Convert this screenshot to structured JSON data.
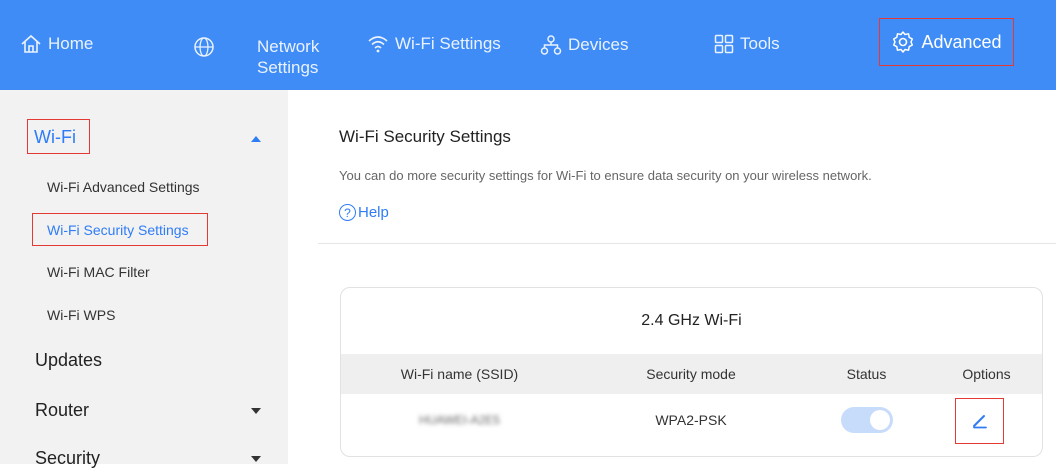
{
  "topbar": {
    "home": "Home",
    "network_line1": "Network",
    "network_line2": "Settings",
    "wifi_settings": "Wi-Fi Settings",
    "devices": "Devices",
    "tools": "Tools",
    "advanced": "Advanced",
    "bg_color": "#3f8cf6"
  },
  "sidebar": {
    "wifi_title": "Wi-Fi",
    "items": [
      "Wi-Fi Advanced Settings",
      "Wi-Fi Security Settings",
      "Wi-Fi MAC Filter",
      "Wi-Fi WPS"
    ],
    "updates": "Updates",
    "router": "Router",
    "security": "Security"
  },
  "main": {
    "title": "Wi-Fi Security Settings",
    "description": "You can do more security settings for Wi-Fi to ensure data security on your wireless network.",
    "help_q": "?",
    "help": "Help"
  },
  "card": {
    "title": "2.4 GHz Wi-Fi",
    "headers": [
      "Wi-Fi name (SSID)",
      "Security mode",
      "Status",
      "Options"
    ],
    "row": {
      "ssid": "HUAWEI-A2E5",
      "security_mode": "WPA2-PSK",
      "status_on": true
    }
  },
  "accent_color": "#2f7cf6",
  "highlight_color": "#e53935"
}
